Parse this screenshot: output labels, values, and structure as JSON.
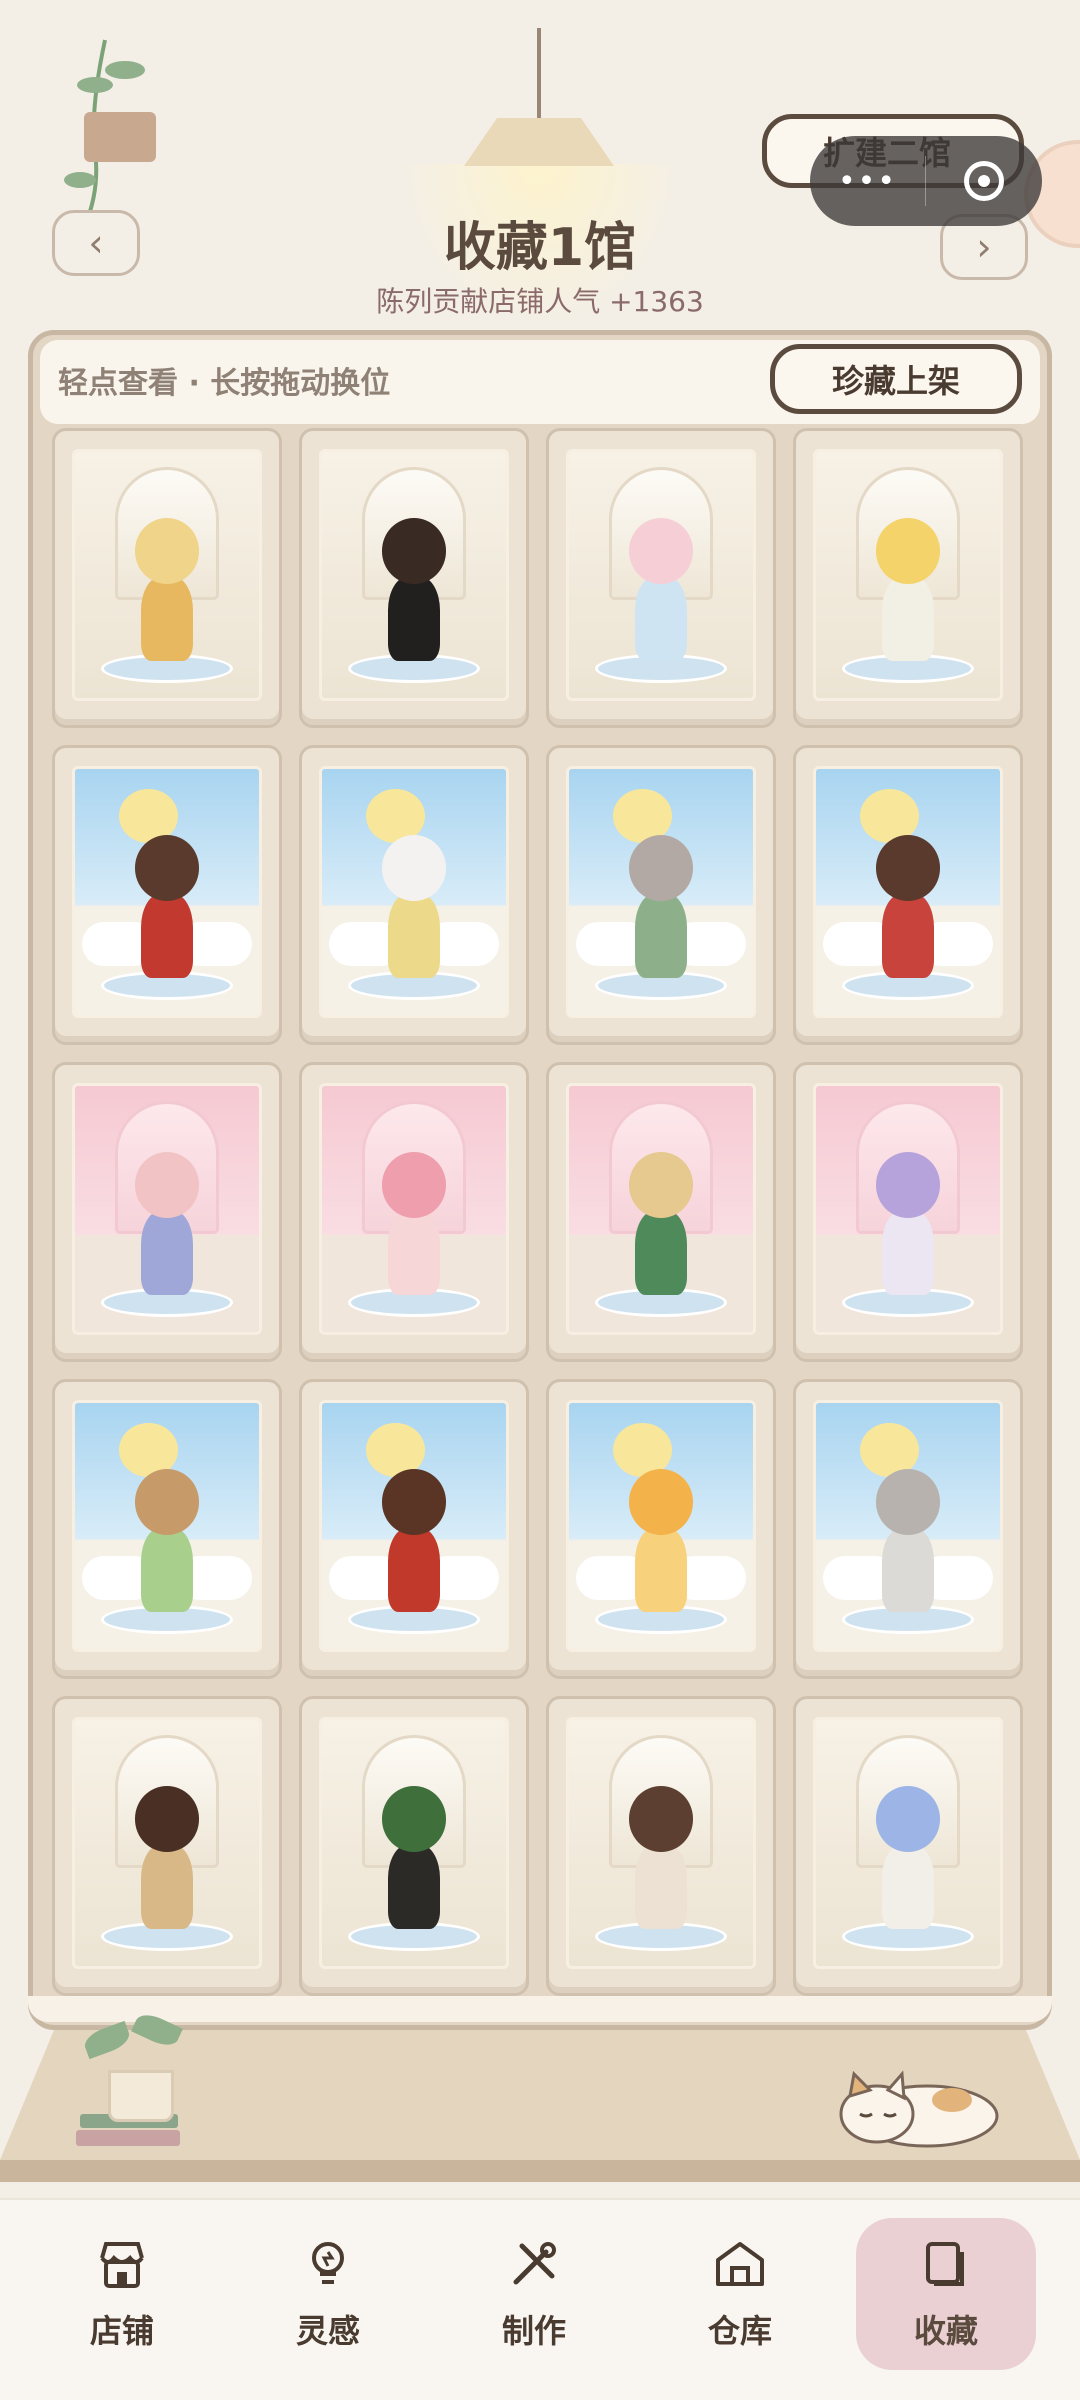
{
  "header": {
    "title": "收藏1馆",
    "subtitle": "陈列贡献店铺人气 +1363",
    "expand_label": "扩建二馆",
    "prev_arrow": "‹",
    "next_arrow": "›",
    "capsule_menu": "•••"
  },
  "toolbar": {
    "tip": "轻点查看 · 长按拖动换位",
    "display_button": "珍藏上架"
  },
  "collection": [
    {
      "theme": "garden",
      "figure": "golden-sun-girl",
      "colors": [
        "#f0d48a",
        "#e8b860"
      ]
    },
    {
      "theme": "garden",
      "figure": "witch-girl-lantern",
      "colors": [
        "#3a2a24",
        "#22201e"
      ]
    },
    {
      "theme": "garden",
      "figure": "pink-hair-girl",
      "colors": [
        "#f6cfd6",
        "#cfe4f2"
      ]
    },
    {
      "theme": "garden",
      "figure": "sunflower-girl",
      "colors": [
        "#f3d36a",
        "#f2efe4"
      ]
    },
    {
      "theme": "sky",
      "figure": "red-dress-girl",
      "colors": [
        "#5a3a2c",
        "#c23a2f"
      ]
    },
    {
      "theme": "sky",
      "figure": "bunny-moon",
      "colors": [
        "#f4f2f0",
        "#ecd989"
      ]
    },
    {
      "theme": "sky",
      "figure": "cat-straw-hat",
      "colors": [
        "#b3a9a4",
        "#8db08a"
      ]
    },
    {
      "theme": "sky",
      "figure": "ribbon-girl",
      "colors": [
        "#5a3a2c",
        "#c7433b"
      ]
    },
    {
      "theme": "pink",
      "figure": "pilot-girl",
      "colors": [
        "#f2c3c4",
        "#9fa7d9"
      ]
    },
    {
      "theme": "pink",
      "figure": "strawberry-girl",
      "colors": [
        "#ef9eae",
        "#f6d6d6"
      ]
    },
    {
      "theme": "pink",
      "figure": "glasses-girl",
      "colors": [
        "#e6c98e",
        "#4f8a5a"
      ]
    },
    {
      "theme": "pink",
      "figure": "purple-sleep-girl",
      "colors": [
        "#b7a3db",
        "#ece6f3"
      ]
    },
    {
      "theme": "sky",
      "figure": "little-deer",
      "colors": [
        "#c79a6a",
        "#a8d08c"
      ]
    },
    {
      "theme": "sky",
      "figure": "cola-boy",
      "colors": [
        "#5a3526",
        "#c0392b"
      ]
    },
    {
      "theme": "sky",
      "figure": "fluffy-lion",
      "colors": [
        "#f4b24a",
        "#f7d17c"
      ]
    },
    {
      "theme": "sky",
      "figure": "grey-hood-girl",
      "colors": [
        "#b7b2ae",
        "#dcdad6"
      ]
    },
    {
      "theme": "garden",
      "figure": "picnic-boy",
      "colors": [
        "#4a3024",
        "#d9b887"
      ]
    },
    {
      "theme": "garden",
      "figure": "monstera-kid",
      "colors": [
        "#3f6f3b",
        "#2c2a26"
      ]
    },
    {
      "theme": "garden",
      "figure": "reading-girl",
      "colors": [
        "#5c3f30",
        "#ece1d3"
      ]
    },
    {
      "theme": "garden",
      "figure": "blue-hair-girl",
      "colors": [
        "#9db4e6",
        "#f2eee8"
      ]
    }
  ],
  "nav": [
    {
      "label": "店铺",
      "icon": "shop-icon",
      "active": false
    },
    {
      "label": "灵感",
      "icon": "lightbulb-icon",
      "active": false
    },
    {
      "label": "制作",
      "icon": "tools-icon",
      "active": false
    },
    {
      "label": "仓库",
      "icon": "warehouse-icon",
      "active": false
    },
    {
      "label": "收藏",
      "icon": "collection-icon",
      "active": true
    }
  ],
  "colors": {
    "accent": "#5b4a3e",
    "active_tab_bg": "#ead0d3",
    "cabinet": "#e3d6c4"
  }
}
